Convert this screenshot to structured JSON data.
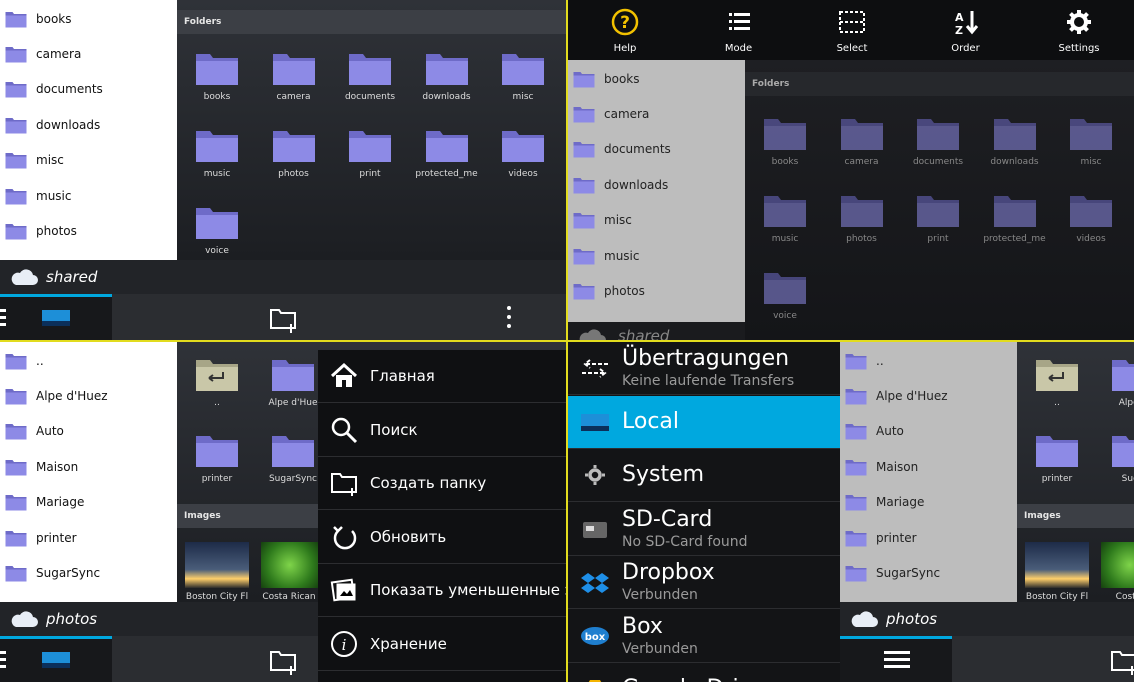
{
  "colors": {
    "accent": "#00a8df",
    "folder": "#8d8ae6",
    "divider": "#e2dc1e"
  },
  "q1": {
    "list": [
      "books",
      "camera",
      "documents",
      "downloads",
      "misc",
      "music",
      "photos"
    ],
    "section": "Folders",
    "folders": [
      "books",
      "camera",
      "documents",
      "downloads",
      "misc",
      "music",
      "photos",
      "print",
      "protected_me",
      "videos",
      "voice"
    ],
    "location": "shared"
  },
  "q2": {
    "toolbar": [
      {
        "label": "Help",
        "icon": "help-icon"
      },
      {
        "label": "Mode",
        "icon": "list-icon"
      },
      {
        "label": "Select",
        "icon": "select-icon"
      },
      {
        "label": "Order",
        "icon": "sort-az-icon"
      },
      {
        "label": "Settings",
        "icon": "gear-icon"
      }
    ],
    "list": [
      "books",
      "camera",
      "documents",
      "downloads",
      "misc",
      "music",
      "photos"
    ],
    "section": "Folders",
    "folders": [
      "books",
      "camera",
      "documents",
      "downloads",
      "misc",
      "music",
      "photos",
      "print",
      "protected_me",
      "videos",
      "voice"
    ],
    "location": "shared"
  },
  "q3": {
    "list": [
      "..",
      "Alpe d'Huez",
      "Auto",
      "Maison",
      "Mariage",
      "printer",
      "SugarSync"
    ],
    "folders": [
      "..",
      "Alpe d'Hue",
      "printer",
      "SugarSync"
    ],
    "images_section": "Images",
    "images": [
      "Boston City Fl",
      "Costa Rican F"
    ],
    "location": "photos",
    "menu": [
      "Главная",
      "Поиск",
      "Создать папку",
      "Обновить",
      "Показать уменьшенные э",
      "Хранение"
    ]
  },
  "q4": {
    "drawer": [
      {
        "title": "Übertragungen",
        "sub": "Keine laufende Transfers",
        "icon": "transfer-icon"
      },
      {
        "title": "Local",
        "sub": "",
        "icon": "local-icon"
      },
      {
        "title": "System",
        "sub": "",
        "icon": "gear-icon"
      },
      {
        "title": "SD-Card",
        "sub": "No SD-Card found",
        "icon": "sdcard-icon"
      },
      {
        "title": "Dropbox",
        "sub": "Verbunden",
        "icon": "dropbox-icon"
      },
      {
        "title": "Box",
        "sub": "Verbunden",
        "icon": "box-icon"
      },
      {
        "title": "Google Drive",
        "sub": "",
        "icon": "google-drive-icon"
      }
    ],
    "list": [
      "..",
      "Alpe d'Huez",
      "Auto",
      "Maison",
      "Mariage",
      "printer",
      "SugarSync"
    ],
    "folders": [
      "..",
      "Alpe d",
      "printer",
      "Suga"
    ],
    "images_section": "Images",
    "images": [
      "Boston City Fl",
      "Costa R"
    ],
    "location": "photos"
  }
}
